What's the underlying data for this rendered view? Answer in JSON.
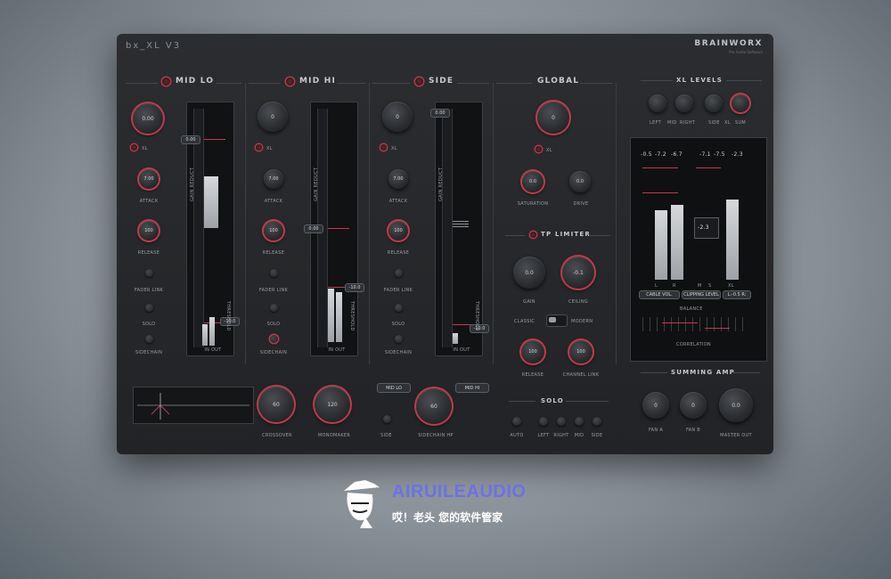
{
  "plugin": {
    "title": "bx_XL V3",
    "brand": "BRAINWORX",
    "brand_sub": "Pro Audio Software"
  },
  "sections": {
    "mid_lo": "MID LO",
    "mid_hi": "MID HI",
    "side": "SIDE",
    "global": "GLOBAL",
    "xl_levels": "XL LEVELS",
    "tp_limiter": "TP LIMITER",
    "solo": "SOLO",
    "summing_amp": "SUMMING AMP"
  },
  "mid_lo": {
    "main_knob": "0.00",
    "xl_label": "XL",
    "attack_value": "7.00",
    "attack_label": "ATTACK",
    "release_value": "100",
    "release_label": "RELEASE",
    "fader_link": "FADER LINK",
    "solo": "SOLO",
    "sidechain": "SIDECHAIN",
    "gain_reduct": "GAIN REDUCT",
    "threshold": "THRESHOLD",
    "fader_value": "0.00",
    "threshold_value": "-10.0",
    "meter_foot": "IN  OUT"
  },
  "mid_hi": {
    "main_knob": "0",
    "xl_label": "XL",
    "attack_value": "7.00",
    "attack_label": "ATTACK",
    "release_value": "100",
    "release_label": "RELEASE",
    "fader_link": "FADER LINK",
    "solo": "SOLO",
    "sidechain": "SIDECHAIN",
    "gain_reduct": "GAIN REDUCT",
    "threshold": "THRESHOLD",
    "fader_value": "0.00",
    "threshold_value": "-10.0",
    "meter_foot": "IN  OUT"
  },
  "side": {
    "main_knob": "0",
    "xl_label": "XL",
    "attack_value": "7.00",
    "attack_label": "ATTACK",
    "release_value": "100",
    "release_label": "RELEASE",
    "fader_link": "FADER LINK",
    "solo": "SOLO",
    "sidechain": "SIDECHAIN",
    "gain_reduct": "GAIN REDUCT",
    "threshold": "THRESHOLD",
    "fader_value": "0.00",
    "threshold_value": "-10.0",
    "meter_foot": "IN  OUT"
  },
  "global": {
    "main_knob": "0",
    "xl_label": "XL",
    "saturation_value": "0.0",
    "saturation_label": "SATURATION",
    "drive_value": "0.0",
    "drive_label": "DRIVE"
  },
  "tp_limiter": {
    "gain_value": "0.0",
    "gain_label": "GAIN",
    "ceiling_value": "-0.1",
    "ceiling_label": "CEILING",
    "switch_left": "CLASSIC",
    "switch_right": "MODERN",
    "release_value": "100",
    "release_label": "RELEASE",
    "channel_link_value": "100",
    "channel_link_label": "CHANNEL LINK"
  },
  "xl_levels": {
    "knobs": [
      "LEFT",
      "MID",
      "RIGHT",
      "SIDE",
      "XL",
      "SUM"
    ],
    "readouts": [
      "-0.5",
      "-7.2",
      "-6.7",
      "-7.1",
      "-7.5",
      "-2.3"
    ],
    "center_readout": "-2.3",
    "dropdown_left": "CABLE VOL.",
    "dropdown_mid": "CLIPPING LEVEL",
    "dropdown_right": "L:-0.5 R:",
    "balance": "BALANCE",
    "correlation": "CORRELATION",
    "meter_labels": [
      "L",
      "R",
      "M",
      "S",
      "XL"
    ]
  },
  "bottom": {
    "crossover_value": "60",
    "crossover_label": "CROSSOVER",
    "side_mono_value": "120",
    "side_mono_label": "MONOMAKER",
    "mid_lo_btn": "MID LO",
    "mid_hi_btn": "MID HI",
    "sidechain_value": "60",
    "side_label": "SIDE",
    "sidechain_label": "SIDECHAIN HP",
    "solo_buttons": [
      "AUTO",
      "LEFT",
      "RIGHT",
      "MID",
      "SIDE"
    ],
    "sum_knobs": [
      {
        "value": "0",
        "label": "FAN A"
      },
      {
        "value": "0",
        "label": "FAN B"
      },
      {
        "value": "0.0",
        "label": "MASTER OUT"
      }
    ]
  },
  "watermark": {
    "name": "AIRUILEAUDIO",
    "tagline": "哎！老头 您的软件管家"
  },
  "colors": {
    "accent_red": "#c13a4d",
    "panel": "#26282b",
    "watermark_blue": "#6b72e6"
  }
}
